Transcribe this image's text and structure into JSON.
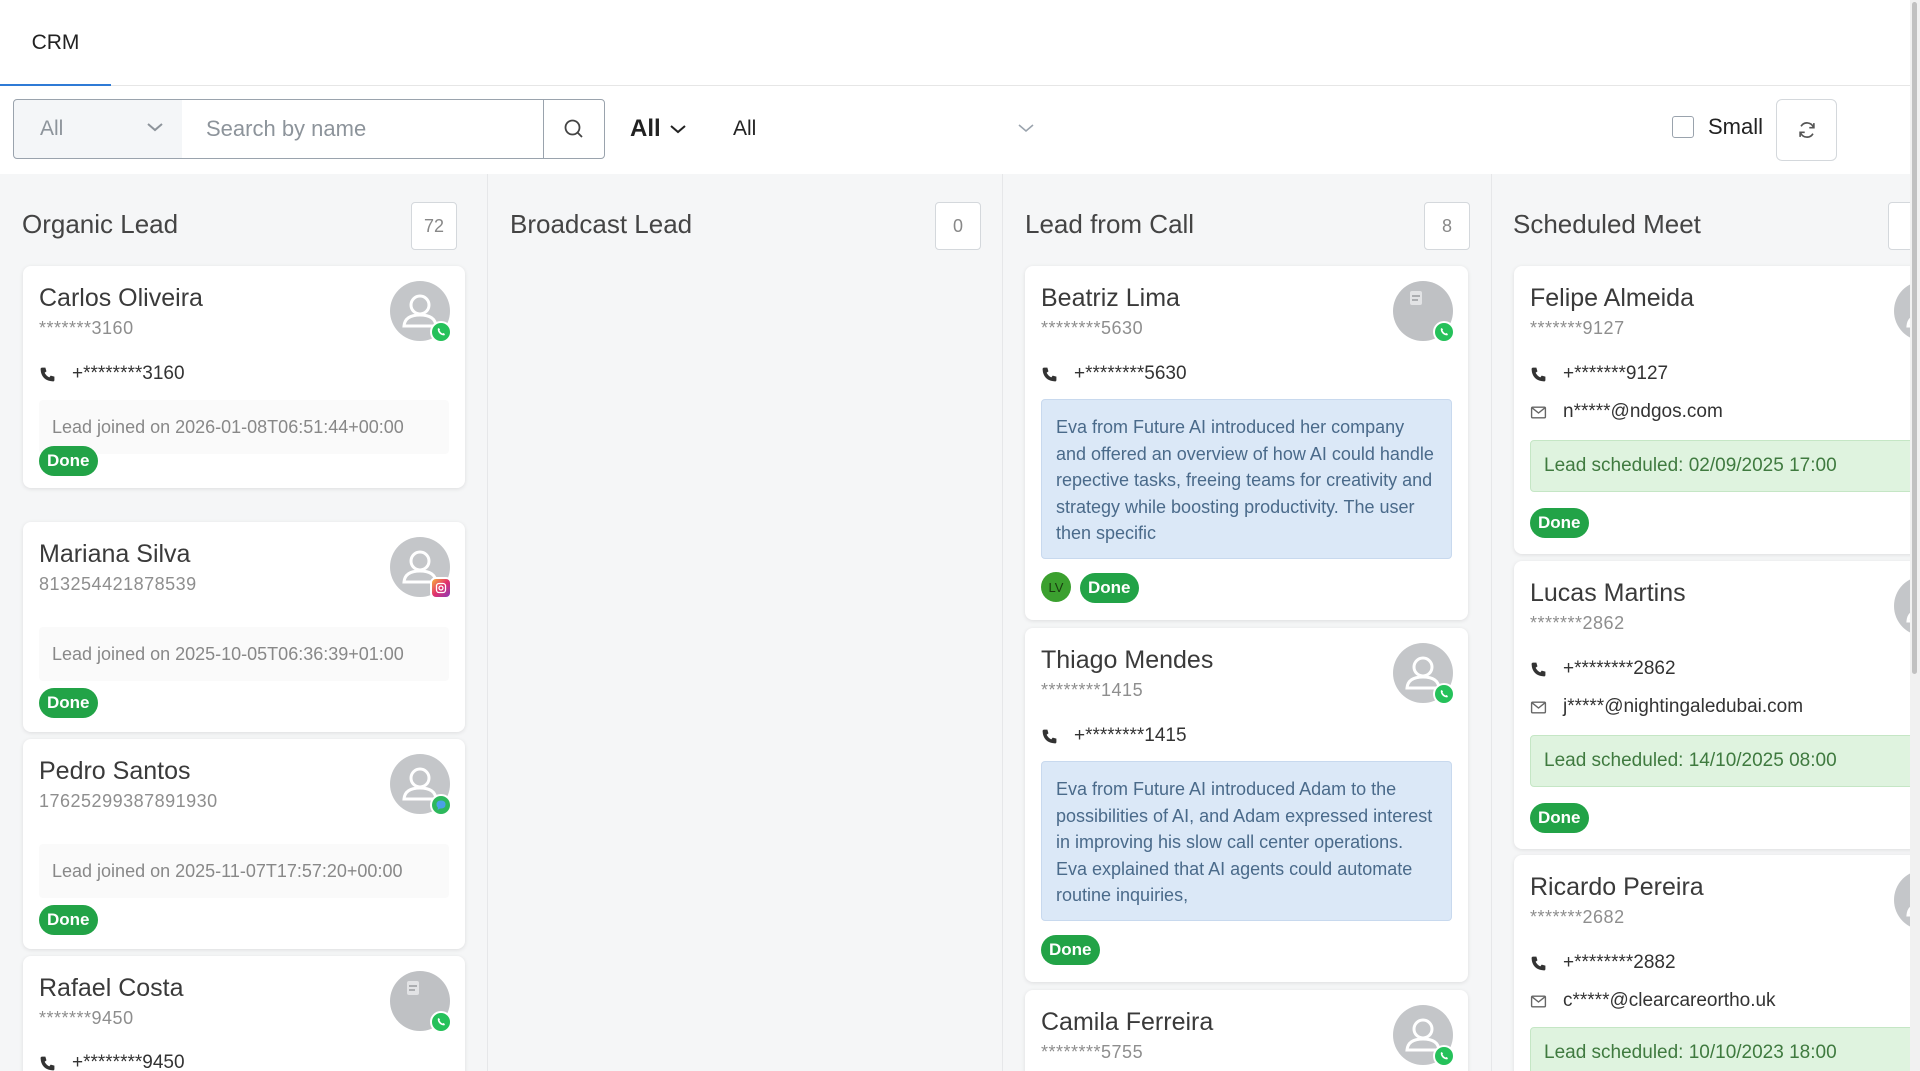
{
  "tabs": [
    {
      "label": "CRM"
    }
  ],
  "toolbar": {
    "filter_select": "All",
    "search_placeholder": "Search by name",
    "dropdown_bold": "All",
    "dropdown_plain": "All",
    "small_label": "Small"
  },
  "columns": [
    {
      "title": "Organic Lead",
      "count": "72",
      "cards": [
        {
          "name": "Carlos Oliveira",
          "sub": "*******3160",
          "phone": "+********3160",
          "joined": "Lead joined on 2026-01-08T06:51:44+00:00",
          "status": "Done",
          "channel": "whatsapp-icon"
        },
        {
          "name": "Mariana Silva",
          "sub": "813254421878539",
          "joined": "Lead joined on 2025-10-05T06:36:39+01:00",
          "status": "Done",
          "channel": "instagram-icon"
        },
        {
          "name": "Pedro Santos",
          "sub": "17625299387891930",
          "joined": "Lead joined on 2025-11-07T17:57:20+00:00",
          "status": "Done",
          "channel": "messenger-icon"
        },
        {
          "name": "Rafael Costa",
          "sub": "*******9450",
          "phone": "+********9450",
          "channel": "whatsapp-icon"
        }
      ]
    },
    {
      "title": "Broadcast Lead",
      "count": "0",
      "cards": []
    },
    {
      "title": "Lead from Call",
      "count": "8",
      "cards": [
        {
          "name": "Beatriz Lima",
          "sub": "********5630",
          "phone": "+********5630",
          "summary": "Eva from Future AI introduced her company and offered an overview of how AI could handle repective tasks, freeing teams for creativity and strategy while boosting productivity. The user then specific",
          "assignee": "LV",
          "status": "Done",
          "channel": "whatsapp-icon"
        },
        {
          "name": "Thiago Mendes",
          "sub": "********1415",
          "phone": "+********1415",
          "summary": "Eva from Future AI introduced Adam to the possibilities of AI, and Adam expressed interest in improving his slow call center operations. Eva explained that AI agents could automate routine inquiries,",
          "status": "Done",
          "channel": "whatsapp-icon"
        },
        {
          "name": "Camila Ferreira",
          "sub": "********5755",
          "channel": "whatsapp-icon"
        }
      ]
    },
    {
      "title": "Scheduled Meet",
      "count": "",
      "cards": [
        {
          "name": "Felipe Almeida",
          "sub": "*******9127",
          "phone": "+*******9127",
          "email": "n*****@ndgos.com",
          "scheduled": "Lead scheduled: 02/09/2025 17:00",
          "status": "Done",
          "channel": "whatsapp-icon"
        },
        {
          "name": "Lucas Martins",
          "sub": "*******2862",
          "phone": "+********2862",
          "email": "j*****@nightingaledubai.com",
          "scheduled": "Lead scheduled: 14/10/2025 08:00",
          "status": "Done",
          "channel": "whatsapp-icon"
        },
        {
          "name": "Ricardo Pereira",
          "sub": "*******2682",
          "phone": "+********2882",
          "email": "c*****@clearcareortho.uk",
          "scheduled": "Lead scheduled: 10/10/2023 18:00",
          "channel": "whatsapp-icon"
        }
      ]
    }
  ]
}
